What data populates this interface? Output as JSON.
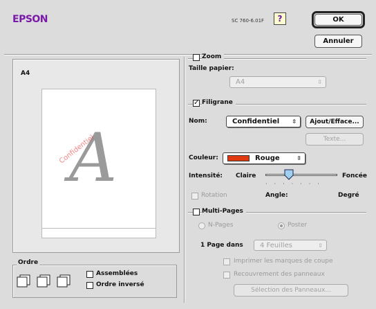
{
  "header": {
    "brand": "EPSON",
    "model": "SC 760-6.01F",
    "help_label": "?",
    "ok_label": "OK",
    "cancel_label": "Annuler",
    "brand_color": "#7a1aa8"
  },
  "preview": {
    "paper_label": "A4",
    "watermark_letter": "A",
    "watermark_text": "Confidentiel"
  },
  "order": {
    "title": "Ordre",
    "collate_label": "Assemblées",
    "reverse_label": "Ordre inversé"
  },
  "zoom": {
    "label": "Zoom",
    "paper_size_label": "Taille papier:",
    "paper_size_value": "A4"
  },
  "watermark": {
    "label": "Filigrane",
    "checked": true,
    "name_label": "Nom:",
    "name_value": "Confidentiel",
    "add_delete_label": "Ajout/Efface...",
    "text_label": "Texte...",
    "color_label": "Couleur:",
    "color_value": "Rouge",
    "color_swatch": "#e03a10",
    "intensity_label": "Intensité:",
    "intensity_light": "Claire",
    "intensity_dark": "Foncée",
    "intensity_level": 0.3,
    "rotation_label": "Rotation",
    "angle_label": "Angle:",
    "degree_label": "Degré"
  },
  "multipage": {
    "label": "Multi-Pages",
    "npages_label": "N-Pages",
    "poster_label": "Poster",
    "page_in_label": "1 Page dans",
    "sheets_value": "4 Feuilles",
    "crop_marks_label": "Imprimer les marques de coupe",
    "overlap_label": "Recouvrement des panneaux",
    "panel_select_label": "Sélection des Panneaux..."
  }
}
